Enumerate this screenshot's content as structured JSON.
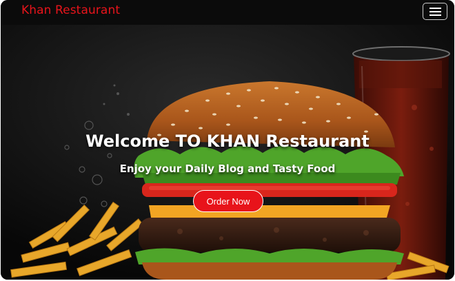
{
  "navbar": {
    "brand": "Khan Restaurant",
    "menu_icon": "hamburger-menu-icon"
  },
  "hero": {
    "title": "Welcome TO KHAN Restaurant",
    "subtitle": "Enjoy your Daily Blog and Tasty Food",
    "cta_label": "Order Now"
  },
  "colors": {
    "brand_red": "#e8141b",
    "button_red": "#e8131a",
    "navbar_bg": "#0b0b0b"
  }
}
